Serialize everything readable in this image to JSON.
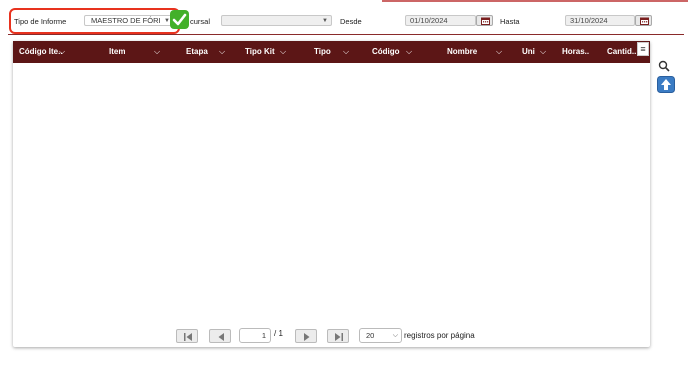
{
  "filters": {
    "report_type_label": "Tipo de Informe",
    "report_type_value": "MAESTRO DE FÓRI",
    "branch_label": "Sucursal",
    "branch_label_visible": "cursal",
    "branch_value": "",
    "from_label": "Desde",
    "from_value": "01/10/2024",
    "to_label": "Hasta",
    "to_value": "31/10/2024"
  },
  "grid": {
    "columns": [
      "Código Ite..",
      "Item",
      "Etapa",
      "Tipo Kit",
      "Tipo",
      "Código",
      "Nombre",
      "Uni",
      "Horas..",
      "Cantid.."
    ],
    "rows": []
  },
  "pagination": {
    "current_page": "1",
    "total_pages": "/ 1",
    "per_page": "20",
    "per_page_label": "registros por página"
  },
  "colors": {
    "header_bg": "#5c1616",
    "highlight_border": "#e8321e",
    "check_green": "#43b02a",
    "upload_blue": "#3b7cc4"
  },
  "icons": [
    "calendar-icon",
    "checkmark-icon",
    "hamburger-menu-icon",
    "search-icon",
    "upload-icon",
    "first-page-icon",
    "previous-page-icon",
    "next-page-icon",
    "last-page-icon"
  ]
}
